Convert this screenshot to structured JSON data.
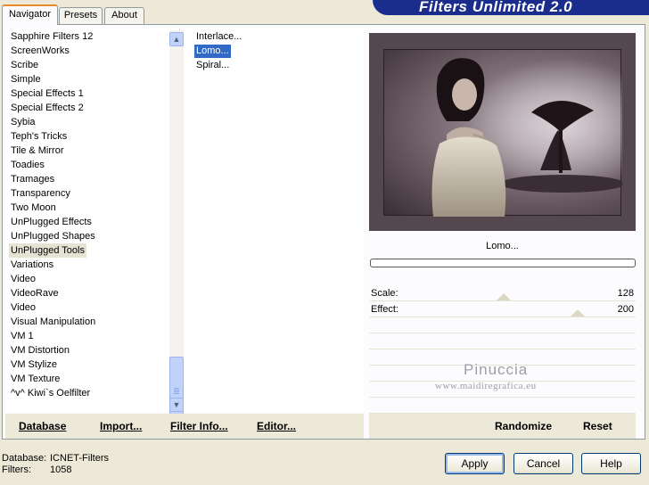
{
  "tabs": [
    "Navigator",
    "Presets",
    "About"
  ],
  "banner_title": "Filters Unlimited 2.0",
  "categories": [
    "Sapphire Filters 12",
    "ScreenWorks",
    "Scribe",
    "Simple",
    "Special Effects 1",
    "Special Effects 2",
    "Sybia",
    "Teph's Tricks",
    "Tile & Mirror",
    "Toadies",
    "Tramages",
    "Transparency",
    "Two Moon",
    "UnPlugged Effects",
    "UnPlugged Shapes",
    "UnPlugged Tools",
    "Variations",
    "Video",
    "VideoRave",
    "Video",
    "Visual Manipulation",
    "VM 1",
    "VM Distortion",
    "VM Stylize",
    "VM Texture",
    "^v^ Kiwi`s Oelfilter"
  ],
  "selected_category": "UnPlugged Tools",
  "filters": [
    "Interlace...",
    "Lomo...",
    "Spiral..."
  ],
  "selected_filter": "Lomo...",
  "filter_name": "Lomo...",
  "progress": 0,
  "params": [
    {
      "label": "Scale:",
      "value": "128"
    },
    {
      "label": "Effect:",
      "value": "200"
    }
  ],
  "watermark": {
    "name": "Pinuccia",
    "url": "www.maidiregrafica.eu"
  },
  "left_buttons": {
    "database": "Database",
    "import": "Import...",
    "filter_info": "Filter Info...",
    "editor": "Editor..."
  },
  "right_buttons": {
    "randomize": "Randomize",
    "reset": "Reset"
  },
  "status": {
    "database_label": "Database:",
    "database_value": "ICNET-Filters",
    "filters_label": "Filters:",
    "filters_value": "1058"
  },
  "dialog_buttons": {
    "apply": "Apply",
    "cancel": "Cancel",
    "help": "Help"
  },
  "colors": {
    "accent": "#316ac5",
    "banner": "#1a2d8c",
    "tab_highlight": "#e68b2c"
  }
}
